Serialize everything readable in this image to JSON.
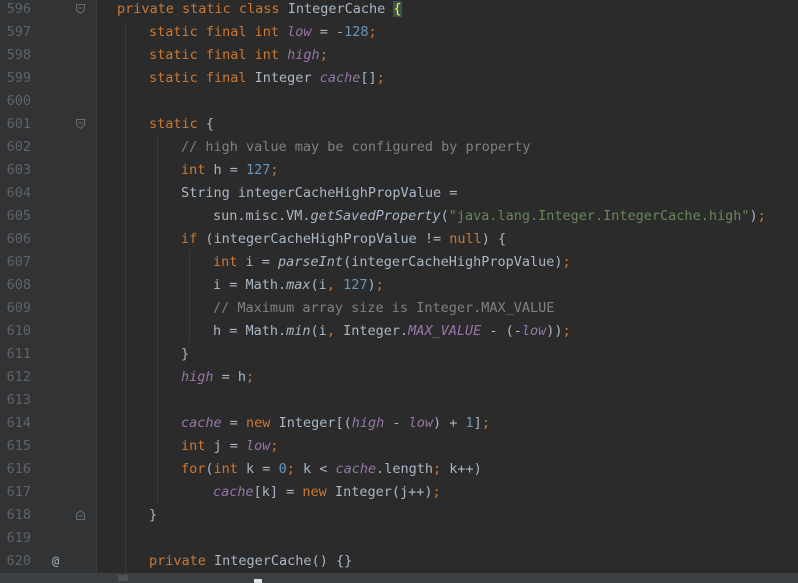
{
  "line_numbers": [
    "596",
    "597",
    "598",
    "599",
    "600",
    "601",
    "602",
    "603",
    "604",
    "605",
    "606",
    "607",
    "608",
    "609",
    "610",
    "611",
    "612",
    "613",
    "614",
    "615",
    "616",
    "617",
    "618",
    "619",
    "620"
  ],
  "override_marker": "@",
  "lines": [
    [
      [
        "kw",
        "private static class "
      ],
      [
        "p",
        "IntegerCache "
      ],
      [
        "bh",
        "{"
      ]
    ],
    [
      [
        "kw",
        "static final int "
      ],
      [
        "fld",
        "low"
      ],
      [
        "p",
        " = -"
      ],
      [
        "num",
        "128"
      ],
      [
        "kw",
        ";"
      ]
    ],
    [
      [
        "kw",
        "static final int "
      ],
      [
        "fld",
        "high"
      ],
      [
        "kw",
        ";"
      ]
    ],
    [
      [
        "kw",
        "static final "
      ],
      [
        "p",
        "Integer "
      ],
      [
        "fld",
        "cache"
      ],
      [
        "p",
        "[]"
      ],
      [
        "kw",
        ";"
      ]
    ],
    [],
    [
      [
        "kw",
        "static "
      ],
      [
        "p",
        "{"
      ]
    ],
    [
      [
        "cmt",
        "// high value may be configured by property"
      ]
    ],
    [
      [
        "kw",
        "int "
      ],
      [
        "p",
        "h = "
      ],
      [
        "num",
        "127"
      ],
      [
        "kw",
        ";"
      ]
    ],
    [
      [
        "p",
        "String integerCacheHighPropValue ="
      ]
    ],
    [
      [
        "p",
        "sun.misc.VM."
      ],
      [
        "mth",
        "getSavedProperty"
      ],
      [
        "p",
        "("
      ],
      [
        "str",
        "\"java.lang.Integer.IntegerCache.high\""
      ],
      [
        "p",
        ")"
      ],
      [
        "kw",
        ";"
      ]
    ],
    [
      [
        "kw",
        "if "
      ],
      [
        "p",
        "(integerCacheHighPropValue != "
      ],
      [
        "kw",
        "null"
      ],
      [
        "p",
        ") {"
      ]
    ],
    [
      [
        "kw",
        "int "
      ],
      [
        "p",
        "i = "
      ],
      [
        "mth",
        "parseInt"
      ],
      [
        "p",
        "(integerCacheHighPropValue)"
      ],
      [
        "kw",
        ";"
      ]
    ],
    [
      [
        "p",
        "i = Math."
      ],
      [
        "mth",
        "max"
      ],
      [
        "p",
        "(i"
      ],
      [
        "kw",
        ", "
      ],
      [
        "num",
        "127"
      ],
      [
        "p",
        ")"
      ],
      [
        "kw",
        ";"
      ]
    ],
    [
      [
        "cmt",
        "// Maximum array size is Integer.MAX_VALUE"
      ]
    ],
    [
      [
        "p",
        "h = Math."
      ],
      [
        "mth",
        "min"
      ],
      [
        "p",
        "(i"
      ],
      [
        "kw",
        ", "
      ],
      [
        "p",
        "Integer."
      ],
      [
        "sfld",
        "MAX_VALUE "
      ],
      [
        "p",
        "- (-"
      ],
      [
        "fld",
        "low"
      ],
      [
        "p",
        "))"
      ],
      [
        "kw",
        ";"
      ]
    ],
    [
      [
        "p",
        "}"
      ]
    ],
    [
      [
        "fld",
        "high "
      ],
      [
        "p",
        "= h"
      ],
      [
        "kw",
        ";"
      ]
    ],
    [],
    [
      [
        "fld",
        "cache "
      ],
      [
        "p",
        "= "
      ],
      [
        "kw",
        "new "
      ],
      [
        "p",
        "Integer[("
      ],
      [
        "fld",
        "high "
      ],
      [
        "p",
        "- "
      ],
      [
        "fld",
        "low"
      ],
      [
        "p",
        ") + "
      ],
      [
        "num",
        "1"
      ],
      [
        "p",
        "]"
      ],
      [
        "kw",
        ";"
      ]
    ],
    [
      [
        "kw",
        "int "
      ],
      [
        "p",
        "j = "
      ],
      [
        "fld",
        "low"
      ],
      [
        "kw",
        ";"
      ]
    ],
    [
      [
        "kw",
        "for"
      ],
      [
        "p",
        "("
      ],
      [
        "kw",
        "int "
      ],
      [
        "p",
        "k = "
      ],
      [
        "num",
        "0"
      ],
      [
        "kw",
        "; "
      ],
      [
        "p",
        "k < "
      ],
      [
        "fld",
        "cache"
      ],
      [
        "p",
        ".length"
      ],
      [
        "kw",
        "; "
      ],
      [
        "p",
        "k++)"
      ]
    ],
    [
      [
        "fld",
        "cache"
      ],
      [
        "p",
        "[k] = "
      ],
      [
        "kw",
        "new "
      ],
      [
        "p",
        "Integer(j++)"
      ],
      [
        "kw",
        ";"
      ]
    ],
    [
      [
        "p",
        "}"
      ]
    ],
    [],
    [
      [
        "kw",
        "private "
      ],
      [
        "p",
        "IntegerCache() {}"
      ]
    ]
  ],
  "indents": [
    0,
    1,
    1,
    1,
    0,
    1,
    2,
    2,
    2,
    3,
    2,
    3,
    3,
    3,
    3,
    2,
    2,
    0,
    2,
    2,
    2,
    3,
    1,
    0,
    1
  ],
  "folds": {
    "0": "open",
    "5": "open",
    "22": "close"
  },
  "override_line": 24,
  "colors": {
    "background": "#2b2b2b",
    "gutter": "#313335",
    "keyword": "#cc7832",
    "number": "#6897bb",
    "string": "#6a8759",
    "comment": "#808080",
    "field": "#9876aa",
    "text": "#a9b7c6"
  }
}
